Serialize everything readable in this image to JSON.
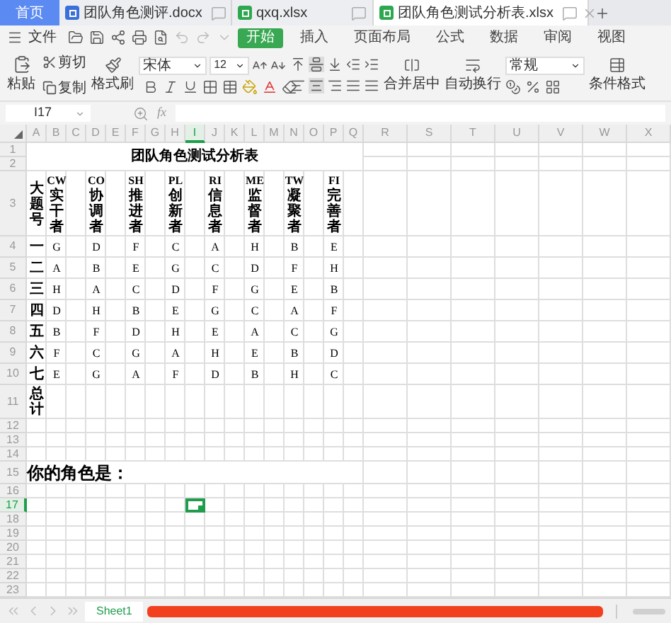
{
  "tabs": [
    {
      "label": "首页",
      "kind": "home",
      "selected": false
    },
    {
      "label": "团队角色测评.docx",
      "kind": "doc",
      "selected": false
    },
    {
      "label": "qxq.xlsx",
      "kind": "sheet",
      "selected": false
    },
    {
      "label": "团队角色测试分析表.xlsx",
      "kind": "sheet",
      "selected": true
    }
  ],
  "menu": {
    "file": "文件",
    "items": [
      {
        "label": "开始",
        "selected": true
      },
      {
        "label": "插入",
        "selected": false
      },
      {
        "label": "页面布局",
        "selected": false
      },
      {
        "label": "公式",
        "selected": false
      },
      {
        "label": "数据",
        "selected": false
      },
      {
        "label": "审阅",
        "selected": false
      },
      {
        "label": "视图",
        "selected": false
      }
    ]
  },
  "ribbon": {
    "paste": "粘贴",
    "cut": "剪切",
    "copy": "复制",
    "format_painter": "格式刷",
    "font": "宋体",
    "size": "12",
    "merge": "合并居中",
    "wrap": "自动换行",
    "number_format": "常规",
    "conditional": "条件格式"
  },
  "formula_bar": {
    "cell_ref": "I17",
    "fx": "fx"
  },
  "columns": [
    {
      "label": "A",
      "selected": false
    },
    {
      "label": "B",
      "selected": false
    },
    {
      "label": "C",
      "selected": false
    },
    {
      "label": "D",
      "selected": false
    },
    {
      "label": "E",
      "selected": false
    },
    {
      "label": "F",
      "selected": false
    },
    {
      "label": "G",
      "selected": false
    },
    {
      "label": "H",
      "selected": false
    },
    {
      "label": "I",
      "selected": true
    },
    {
      "label": "J",
      "selected": false
    },
    {
      "label": "K",
      "selected": false
    },
    {
      "label": "L",
      "selected": false
    },
    {
      "label": "M",
      "selected": false
    },
    {
      "label": "N",
      "selected": false
    },
    {
      "label": "O",
      "selected": false
    },
    {
      "label": "P",
      "selected": false
    },
    {
      "label": "Q",
      "selected": false
    },
    {
      "label": "R",
      "selected": false
    },
    {
      "label": "S",
      "selected": false
    },
    {
      "label": "T",
      "selected": false
    },
    {
      "label": "U",
      "selected": false
    },
    {
      "label": "V",
      "selected": false
    },
    {
      "label": "W",
      "selected": false
    },
    {
      "label": "X",
      "selected": false
    }
  ],
  "rows": [
    {
      "label": "1",
      "selected": false
    },
    {
      "label": "2",
      "selected": false
    },
    {
      "label": "3",
      "selected": false
    },
    {
      "label": "4",
      "selected": false
    },
    {
      "label": "5",
      "selected": false
    },
    {
      "label": "6",
      "selected": false
    },
    {
      "label": "7",
      "selected": false
    },
    {
      "label": "8",
      "selected": false
    },
    {
      "label": "9",
      "selected": false
    },
    {
      "label": "10",
      "selected": false
    },
    {
      "label": "11",
      "selected": false
    },
    {
      "label": "12",
      "selected": false
    },
    {
      "label": "13",
      "selected": false
    },
    {
      "label": "14",
      "selected": false
    },
    {
      "label": "15",
      "selected": false
    },
    {
      "label": "16",
      "selected": false
    },
    {
      "label": "17",
      "selected": true
    },
    {
      "label": "18",
      "selected": false
    },
    {
      "label": "19",
      "selected": false
    },
    {
      "label": "20",
      "selected": false
    },
    {
      "label": "21",
      "selected": false
    },
    {
      "label": "22",
      "selected": false
    },
    {
      "label": "23",
      "selected": false
    }
  ],
  "sheet": {
    "title": "团队角色测试分析表",
    "question_label": "大题号",
    "roles": [
      {
        "code": "CW",
        "name": "实干者"
      },
      {
        "code": "CO",
        "name": "协调者"
      },
      {
        "code": "SH",
        "name": "推进者"
      },
      {
        "code": "PL",
        "name": "创新者"
      },
      {
        "code": "RI",
        "name": "信息者"
      },
      {
        "code": "ME",
        "name": "监督者"
      },
      {
        "code": "TW",
        "name": "凝聚者"
      },
      {
        "code": "FI",
        "name": "完善者"
      }
    ],
    "answers": [
      {
        "number": "一",
        "letters": [
          "G",
          "D",
          "F",
          "C",
          "A",
          "H",
          "B",
          "E"
        ]
      },
      {
        "number": "二",
        "letters": [
          "A",
          "B",
          "E",
          "G",
          "C",
          "D",
          "F",
          "H"
        ]
      },
      {
        "number": "三",
        "letters": [
          "H",
          "A",
          "C",
          "D",
          "F",
          "G",
          "E",
          "B"
        ]
      },
      {
        "number": "四",
        "letters": [
          "D",
          "H",
          "B",
          "E",
          "G",
          "C",
          "A",
          "F"
        ]
      },
      {
        "number": "五",
        "letters": [
          "B",
          "F",
          "D",
          "H",
          "E",
          "A",
          "C",
          "G"
        ]
      },
      {
        "number": "六",
        "letters": [
          "F",
          "C",
          "G",
          "A",
          "H",
          "E",
          "B",
          "D"
        ]
      },
      {
        "number": "七",
        "letters": [
          "E",
          "G",
          "A",
          "F",
          "D",
          "B",
          "H",
          "C"
        ]
      }
    ],
    "total": "总计",
    "prompt": "你的角色是："
  },
  "sheet_tabs": [
    {
      "label": "Sheet1",
      "selected": true
    }
  ]
}
